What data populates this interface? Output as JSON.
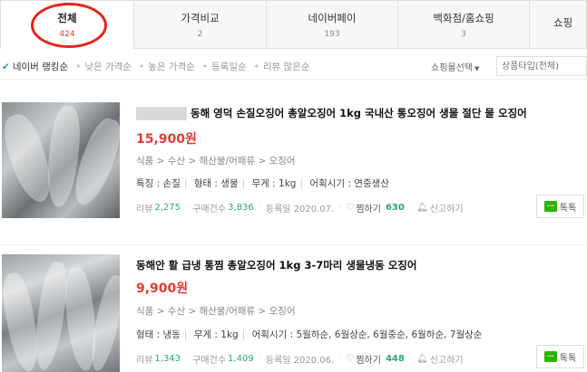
{
  "tabs": [
    {
      "label": "전체",
      "count": "424"
    },
    {
      "label": "가격비교",
      "count": "2"
    },
    {
      "label": "네이버페이",
      "count": "193"
    },
    {
      "label": "백화점/홈쇼핑",
      "count": "3"
    },
    {
      "label": "쇼핑",
      "count": ""
    }
  ],
  "sort": {
    "options": [
      "네이버 랭킹순",
      "낮은 가격순",
      "높은 가격순",
      "등록일순",
      "리뷰 많은순"
    ],
    "mall_select": "쇼핑몰선택",
    "type_placeholder": "상품타입(전체)"
  },
  "products": [
    {
      "title": "동해 영덕 손질오징어 총알오징어 1kg 국내산 통오징어 생물 절단 물 오징어",
      "price": "15,900원",
      "category": "식품 > 수산 > 해산물/어패류 > 오징어",
      "attrs": [
        "특징 : 손질",
        "형태 : 생물",
        "무게 : 1kg",
        "어획시기 : 연중생산"
      ],
      "review_label": "리뷰",
      "review_count": "2,275",
      "purchase_label": "구매건수",
      "purchase_count": "3,836",
      "reg_date": "등록일 2020.07.",
      "zzim_label": "찜하기",
      "zzim_count": "630",
      "report": "신고하기",
      "talk": "톡톡"
    },
    {
      "title": "동해안 활 급냉 통찜 총알오징어 1kg 3-7마리 생물냉동 오징어",
      "price": "9,900원",
      "category": "식품 > 수산 > 해산물/어패류 > 오징어",
      "attrs": [
        "형태 : 냉동",
        "무게 : 1kg",
        "어획시기 : 5월하순, 6월상순, 6월중순, 6월하순, 7월상순"
      ],
      "review_label": "리뷰",
      "review_count": "1,343",
      "purchase_label": "구매건수",
      "purchase_count": "1,409",
      "reg_date": "등록일 2020.06.",
      "zzim_label": "찜하기",
      "zzim_count": "448",
      "report": "신고하기",
      "talk": "톡톡"
    }
  ]
}
